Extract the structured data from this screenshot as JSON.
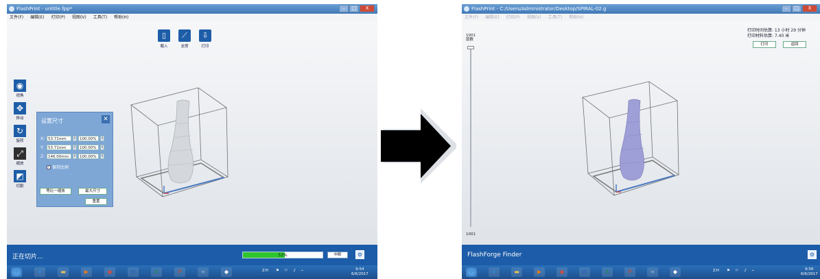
{
  "left_window": {
    "title": "FlashPrint - untitle.fpp*",
    "window_controls": [
      "–",
      "□",
      "X"
    ],
    "menu": [
      "文件(F)",
      "编辑(E)",
      "打印(P)",
      "视图(V)",
      "工具(T)",
      "帮助(H)"
    ],
    "top_toolbar": [
      {
        "icon": "file-icon",
        "label": "载入"
      },
      {
        "icon": "support-icon",
        "label": "支撑"
      },
      {
        "icon": "print-icon",
        "label": "打印"
      }
    ],
    "side_toolbar": [
      {
        "icon": "eye-icon",
        "label": "视角"
      },
      {
        "icon": "move-icon",
        "label": "移动"
      },
      {
        "icon": "rotate-icon",
        "label": "旋转"
      },
      {
        "icon": "scale-icon",
        "label": "缩放"
      },
      {
        "icon": "cut-icon",
        "label": "切割"
      }
    ],
    "scale_panel": {
      "title": "设置尺寸",
      "rows": [
        {
          "axis": "X:",
          "size": "53.71mm",
          "percent": "100.00%"
        },
        {
          "axis": "Y:",
          "size": "53.71mm",
          "percent": "100.00%"
        },
        {
          "axis": "Z:",
          "size": "146.00mm",
          "percent": "100.00%"
        }
      ],
      "keep_ratio_label": "保持比例",
      "keep_ratio_checked": "✓",
      "btn_fit": "等比一缩放",
      "btn_max": "最大尺寸",
      "btn_reset": "重置"
    },
    "status": {
      "text": "正在切片...",
      "progress_percent": 53,
      "progress_label": "53%",
      "cancel_label": "中断"
    },
    "clock": {
      "time": "9:54",
      "date": "6/6/2017"
    },
    "tray_text": "ZH"
  },
  "right_window": {
    "title": "FlashPrint - C:/Users/Administrator/Desktop/SPIRAL-02.g",
    "window_controls": [
      "–",
      "□",
      "X"
    ],
    "menu": [
      "文件(F)",
      "编辑(E)",
      "打印(P)",
      "视图(V)",
      "工具(T)",
      "帮助(H)"
    ],
    "layer_top_value": "1001",
    "layer_top_label": "层数",
    "layer_bottom_value": "1001",
    "info": {
      "time_line": "打印时间估算: 13 小时 29 分钟",
      "material_line": "打印材料估算: 7.40 米",
      "print_btn": "打印",
      "back_btn": "返回"
    },
    "status_text": "FlashForge Finder",
    "clock": {
      "time": "9:56",
      "date": "6/6/2017"
    },
    "tray_text": "ZH"
  },
  "taskbar_apps": [
    {
      "icon": "start-icon",
      "glyph": "❖",
      "color": "#3b8fd8"
    },
    {
      "icon": "ie-icon",
      "glyph": "e",
      "color": "#2f89d9"
    },
    {
      "icon": "folder-icon",
      "glyph": "▬",
      "color": "#e8c25a"
    },
    {
      "icon": "media-icon",
      "glyph": "▶",
      "color": "#e07a20"
    },
    {
      "icon": "chrome-icon",
      "glyph": "◉",
      "color": "#d94b3a"
    },
    {
      "icon": "word-icon",
      "glyph": "W",
      "color": "#2b5fb5"
    },
    {
      "icon": "excel-icon",
      "glyph": "X",
      "color": "#1e8a3e"
    },
    {
      "icon": "powerpoint-icon",
      "glyph": "P",
      "color": "#d2461f"
    },
    {
      "icon": "notepad-icon",
      "glyph": "≡",
      "color": "#8aa7c8"
    },
    {
      "icon": "flashprint-icon",
      "glyph": "◆",
      "color": "#ffffff"
    }
  ],
  "colors": {
    "accent_blue": "#1c5ca8",
    "panel_blue": "#7ea7d6",
    "progress_green": "#2ec52e",
    "vase_left": "#d4d7db",
    "vase_right": "#9f9fd8"
  }
}
